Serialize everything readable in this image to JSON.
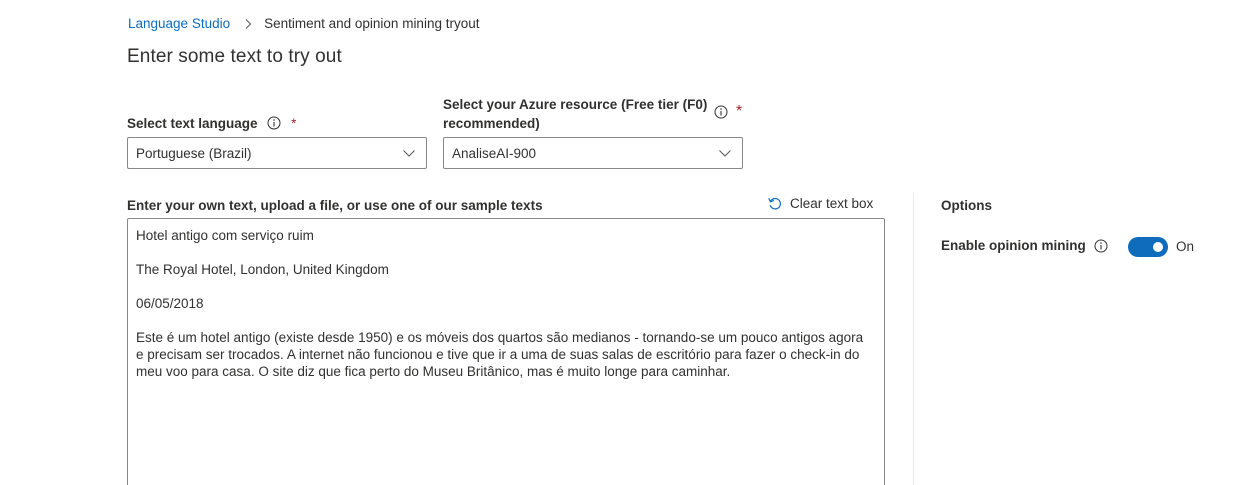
{
  "breadcrumb": {
    "root": "Language Studio",
    "current": "Sentiment and opinion mining tryout"
  },
  "page_title": "Enter some text to try out",
  "language_select": {
    "label": "Select text language",
    "required_mark": "*",
    "value": "Portuguese (Brazil)"
  },
  "resource_select": {
    "label": "Select your Azure resource (Free tier (F0) recommended)",
    "required_mark": "*",
    "value": "AnaliseAI-900"
  },
  "text_input": {
    "label": "Enter your own text, upload a file, or use one of our sample texts",
    "clear_label": "Clear text box",
    "paragraphs": [
      "Hotel antigo com serviço ruim",
      "The Royal Hotel, London, United Kingdom",
      "06/05/2018",
      "Este é um hotel antigo (existe desde 1950) e os móveis dos quartos são medianos - tornando-se um pouco antigos agora e precisam ser trocados. A internet não funcionou e tive que ir a uma de suas salas de escritório para fazer o check-in do meu voo para casa. O site diz que fica perto do Museu Britânico, mas é muito longe para caminhar."
    ]
  },
  "options": {
    "title": "Options",
    "opinion_mining_label": "Enable opinion mining",
    "opinion_mining_state": "On",
    "opinion_mining_enabled": true
  },
  "colors": {
    "accent": "#0f6cbd",
    "required": "#a4262c",
    "text": "#323130",
    "border": "#8a8886"
  }
}
